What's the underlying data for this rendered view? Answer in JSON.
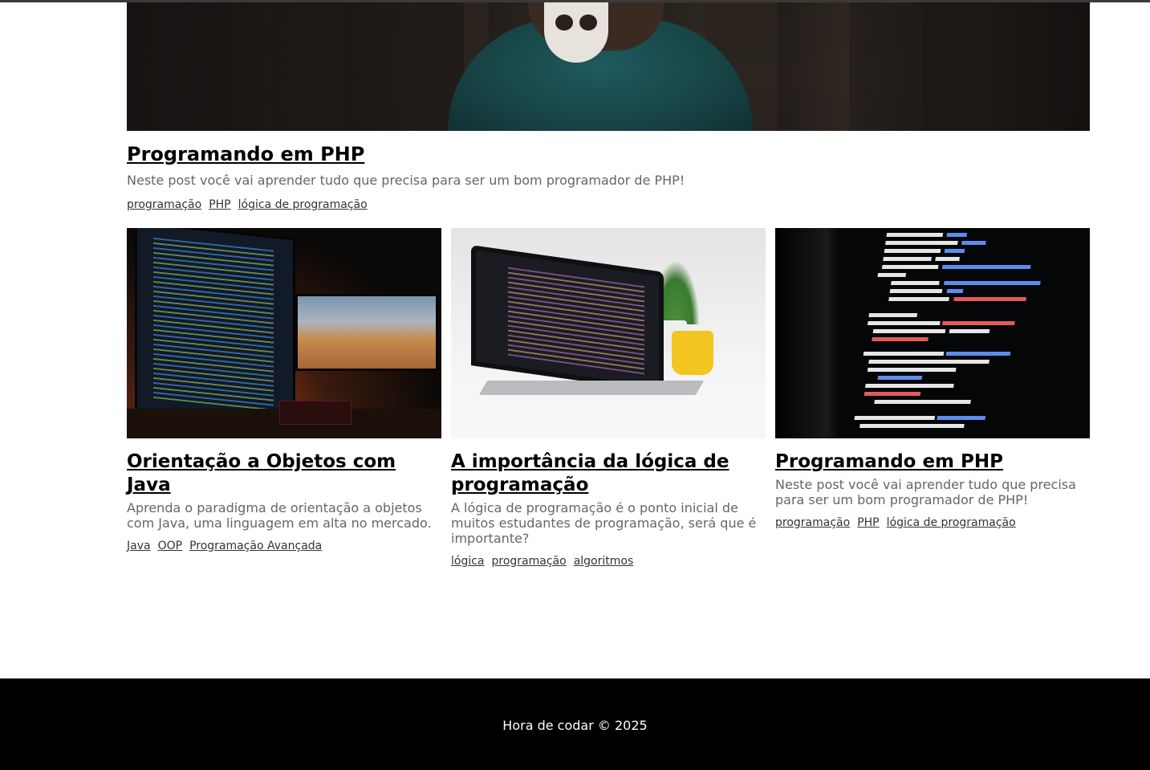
{
  "featured": {
    "title": "Programando em PHP",
    "description": "Neste post você vai aprender tudo que precisa para ser um bom programador de PHP!",
    "tags": [
      "programação",
      "PHP",
      "lógica de programação"
    ]
  },
  "posts": [
    {
      "title": "Orientação a Objetos com Java",
      "description": "Aprenda o paradigma de orientação a objetos com Java, uma linguagem em alta no mercado.",
      "tags": [
        "Java",
        "OOP",
        "Programação Avançada"
      ]
    },
    {
      "title": "A importância da lógica de programação",
      "description": "A lógica de programação é o ponto inicial de muitos estudantes de programação, será que é importante?",
      "tags": [
        "lógica",
        "programação",
        "algoritmos"
      ]
    },
    {
      "title": "Programando em PHP",
      "description": "Neste post você vai aprender tudo que precisa para ser um bom programador de PHP!",
      "tags": [
        "programação",
        "PHP",
        "lógica de programação"
      ]
    }
  ],
  "footer": {
    "text": "Hora de codar © 2025"
  }
}
